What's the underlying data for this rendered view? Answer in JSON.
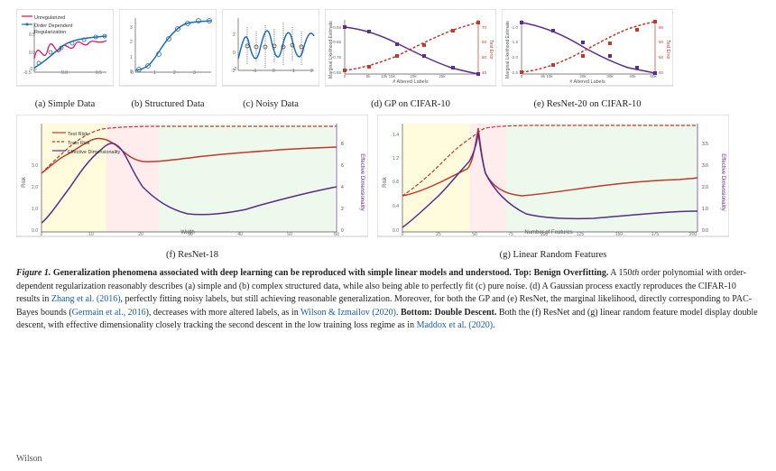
{
  "figure": {
    "title": "Figure 1.",
    "caption_bold": "Generalization phenomena associated with deep learning can be reproduced with simple linear models and understood.",
    "caption_text": " Top: Benign Overfitting. A 150th order polynomial with order-dependent regularization reasonably describes (a) simple and (b) complex structured data, while also being able to perfectly fit (c) pure noise. (d) A Gaussian process exactly reproduces the CIFAR-10 results in ",
    "ref1": "Zhang et al. (2016)",
    "caption_text2": ", perfectly fitting noisy labels, but still achieving reasonable generalization. Moreover, for both the GP and (e) ResNet, the marginal likelihood, directly corresponding to PAC-Bayes bounds (",
    "ref2": "Germain et al., 2016",
    "caption_text3": "), decreases with more altered labels, as in ",
    "ref3": "Wilson & Izmailov (2020)",
    "caption_text4": ". Bottom: Double Descent. Both the (f) ResNet and (g) linear random feature model display double descent, with effective dimensionality closely tracking the second descent in the low training loss regime as in ",
    "ref4": "Maddox et al. (2020)",
    "caption_text5": ".",
    "charts": {
      "a_label": "(a) Simple Data",
      "b_label": "(b) Structured Data",
      "c_label": "(c) Noisy Data",
      "d_label": "(d) GP on CIFAR-10",
      "e_label": "(e) ResNet-20 on CIFAR-10",
      "f_label": "(f) ResNet-18",
      "g_label": "(g) Linear Random Features"
    },
    "legend": {
      "unregularized": "Unregularized",
      "order_dependent": "Order Dependent Regularization",
      "test_risk": "Test Risk",
      "train_risk": "Train Risk",
      "effective_dim": "Effective Dimensionality"
    },
    "wilson_text": "Wilson"
  }
}
